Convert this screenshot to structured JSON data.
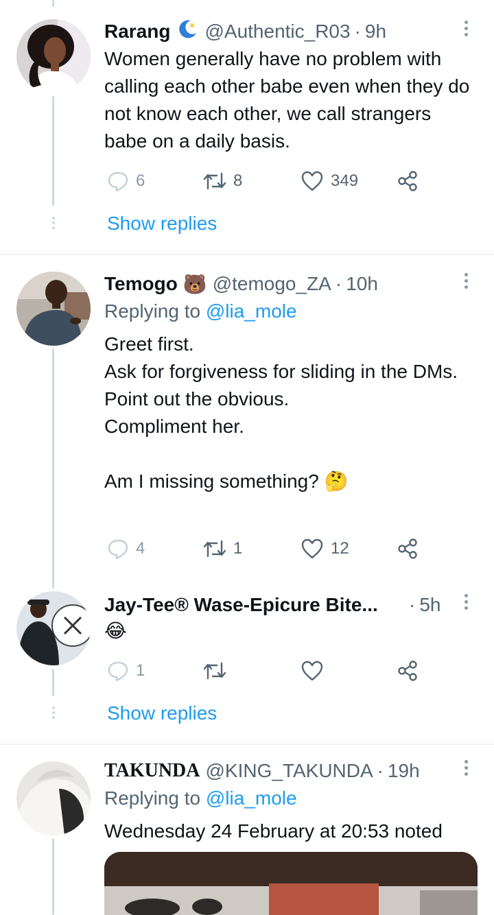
{
  "tweets": [
    {
      "name": "Rarang",
      "handle": "@Authentic_R03",
      "time": "9h",
      "text": "Women generally have no problem with calling each other babe even when they do not know each other, we call strangers babe on a daily basis.",
      "replies": "6",
      "retweets": "8",
      "likes": "349",
      "show_replies": "Show replies"
    },
    {
      "name": "Temogo",
      "emoji": "🐻",
      "handle": "@temogo_ZA",
      "time": "10h",
      "replying_prefix": "Replying to",
      "replying_to": "@lia_mole",
      "text": "Greet first.\nAsk for forgiveness for sliding in the DMs.\nPoint out the obvious.\nCompliment her.\n\nAm I missing something?",
      "text_emoji": "🤔",
      "replies": "4",
      "retweets": "1",
      "likes": "12"
    },
    {
      "name": "Jay-Tee® Wase-Epicure Bite...",
      "time": "5h",
      "text": "😂",
      "replies": "1",
      "retweets": "",
      "likes": "",
      "show_replies": "Show replies"
    },
    {
      "name": "TAKUNDA",
      "handle": "@KING_TAKUNDA",
      "time": "19h",
      "replying_prefix": "Replying to",
      "replying_to": "@lia_mole",
      "text": "Wednesday 24 February at 20:53 noted"
    }
  ],
  "icons": {
    "reply": "reply-icon",
    "retweet": "retweet-icon",
    "like": "heart-icon",
    "share": "share-icon",
    "more": "more-icon"
  },
  "colors": {
    "link": "#1d9bf0",
    "muted": "#536471",
    "line": "#cfd9de"
  }
}
